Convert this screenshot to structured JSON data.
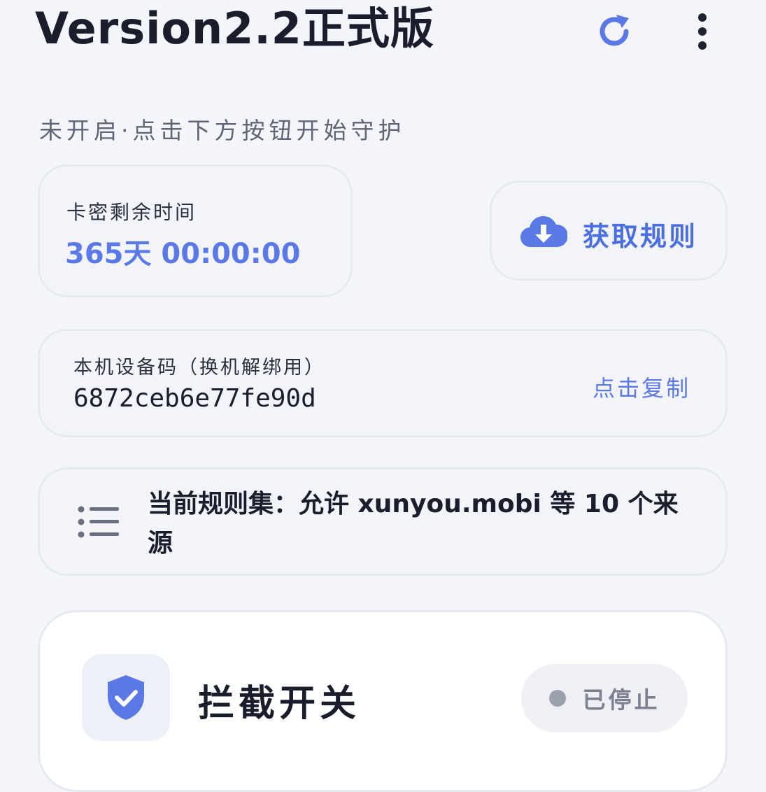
{
  "header": {
    "title": "Version2.2正式版",
    "refresh_icon": "refresh-icon",
    "more_icon": "more-vertical-icon"
  },
  "status": {
    "text": "未开启·点击下方按钮开始守护"
  },
  "time_card": {
    "label": "卡密剩余时间",
    "value": "365天 00:00:00"
  },
  "rules_button": {
    "icon": "cloud-download-icon",
    "label": "获取规则"
  },
  "device_card": {
    "label": "本机设备码（换机解绑用）",
    "code": "6872ceb6e77fe90d",
    "copy_label": "点击复制"
  },
  "ruleset_card": {
    "icon": "list-icon",
    "text": "当前规则集：允许 xunyou.mobi 等 10 个来源"
  },
  "switch_card": {
    "icon": "shield-check-icon",
    "title": "拦截开关",
    "status": "已停止"
  },
  "colors": {
    "accent": "#5b79e6",
    "background": "#f4f5fb",
    "stopped_dot": "#9aa0ad"
  }
}
